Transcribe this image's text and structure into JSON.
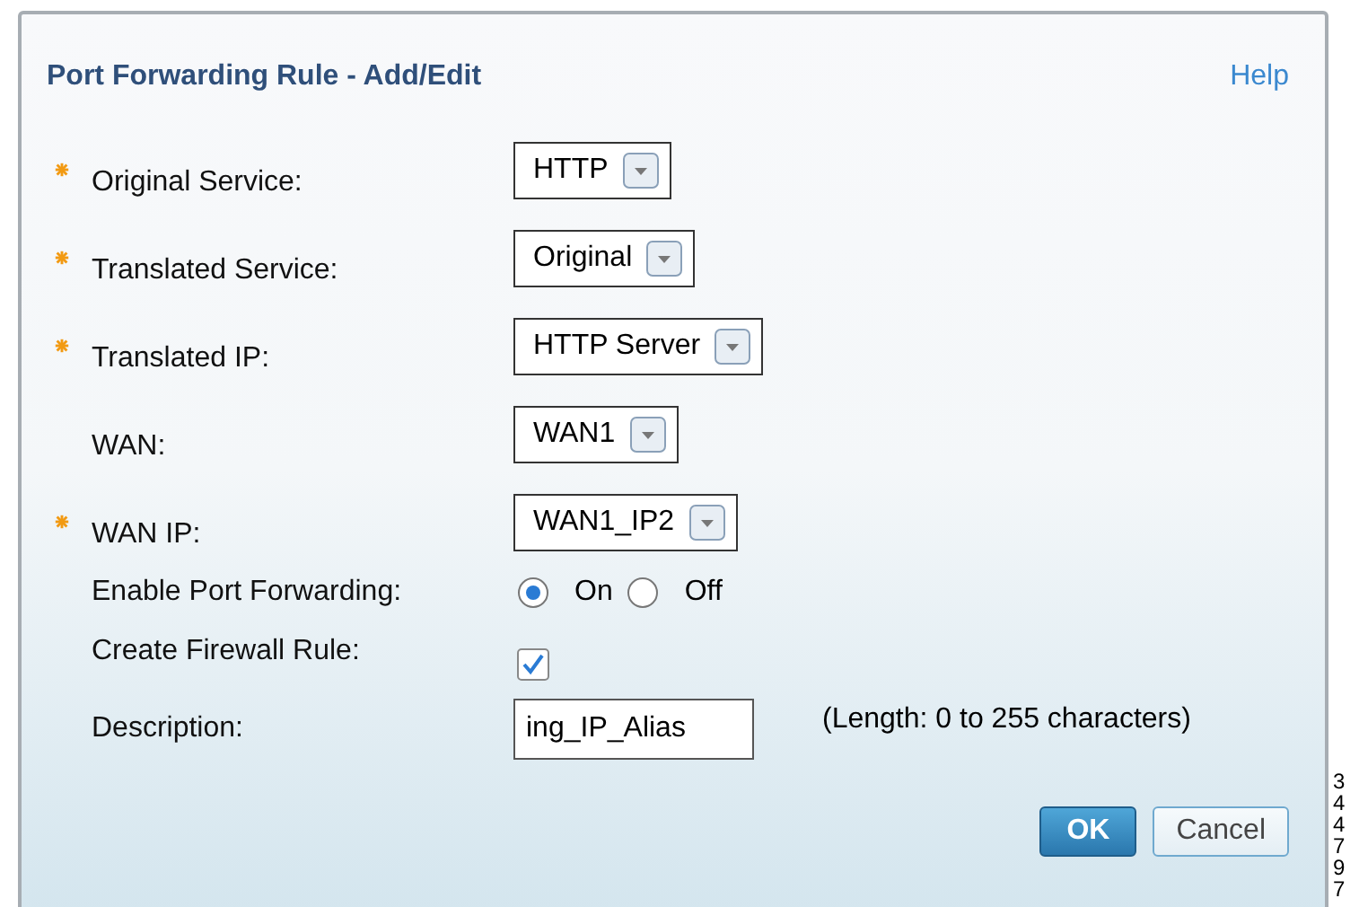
{
  "dialog": {
    "title": "Port Forwarding Rule - Add/Edit",
    "help_link": "Help"
  },
  "fields": [
    {
      "kind": "select",
      "label": "Original Service:",
      "required": true,
      "value": "HTTP"
    },
    {
      "kind": "select",
      "label": "Translated Service:",
      "required": true,
      "value": "Original"
    },
    {
      "kind": "select",
      "label": "Translated IP:",
      "required": true,
      "value": "HTTP Server"
    },
    {
      "kind": "select",
      "label": "WAN:",
      "required": false,
      "value": "WAN1"
    },
    {
      "kind": "select",
      "label": "WAN IP:",
      "required": true,
      "value": "WAN1_IP2"
    },
    {
      "kind": "radio",
      "label": "Enable Port Forwarding:",
      "required": false,
      "options": [
        {
          "label": "On",
          "selected": true
        },
        {
          "label": "Off",
          "selected": false
        }
      ]
    },
    {
      "kind": "checkbox",
      "label": "Create Firewall Rule:",
      "required": false,
      "checked": true
    },
    {
      "kind": "text",
      "label": "Description:",
      "required": false,
      "value": "ing_IP_Alias",
      "hint": "(Length: 0 to 255 characters)"
    }
  ],
  "buttons": [
    {
      "label": "OK",
      "primary": true
    },
    {
      "label": "Cancel",
      "primary": false
    }
  ],
  "side_label": "344797"
}
